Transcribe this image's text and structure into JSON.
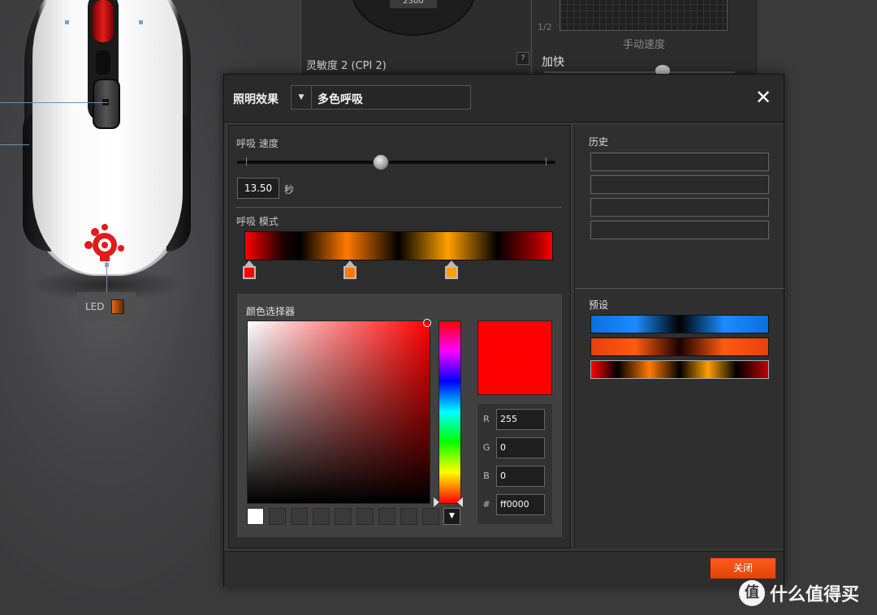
{
  "background": {
    "led_label": "LED",
    "cpi_dial_value": "2300",
    "cpi2_label": "灵敏度 2 (CPI 2)",
    "help_mark": "?",
    "half_label": "1/2",
    "manual_speed_label": "手动速度",
    "acceleration_label": "加快"
  },
  "dialog": {
    "lighting_label": "照明效果",
    "effect_select_value": "多色呼吸",
    "close_icon": "close-icon",
    "breath_speed_label": "呼吸 速度",
    "breath_speed_value": "13.50",
    "breath_speed_slider_fraction": 0.45,
    "seconds_label": "秒",
    "breath_mode_label": "呼吸 模式",
    "mode_stops": [
      {
        "color": "#ff0000"
      },
      {
        "color": "#ff7a00"
      },
      {
        "color": "#ffa000"
      }
    ],
    "color_picker": {
      "label": "颜色选择器",
      "selected_color": "#ff0000",
      "r_label": "R",
      "r_value": "255",
      "g_label": "G",
      "g_value": "0",
      "b_label": "B",
      "b_value": "0",
      "hex_label": "#",
      "hex_value": "ff0000"
    },
    "history_label": "历史",
    "presets_label": "预设",
    "presets": [
      {
        "name": "blue-black-blue"
      },
      {
        "name": "orange-black-orange"
      },
      {
        "name": "multi-color-breath"
      }
    ],
    "close_button_label": "关闭"
  },
  "watermark": {
    "circle": "值",
    "text": "什么值得买"
  }
}
